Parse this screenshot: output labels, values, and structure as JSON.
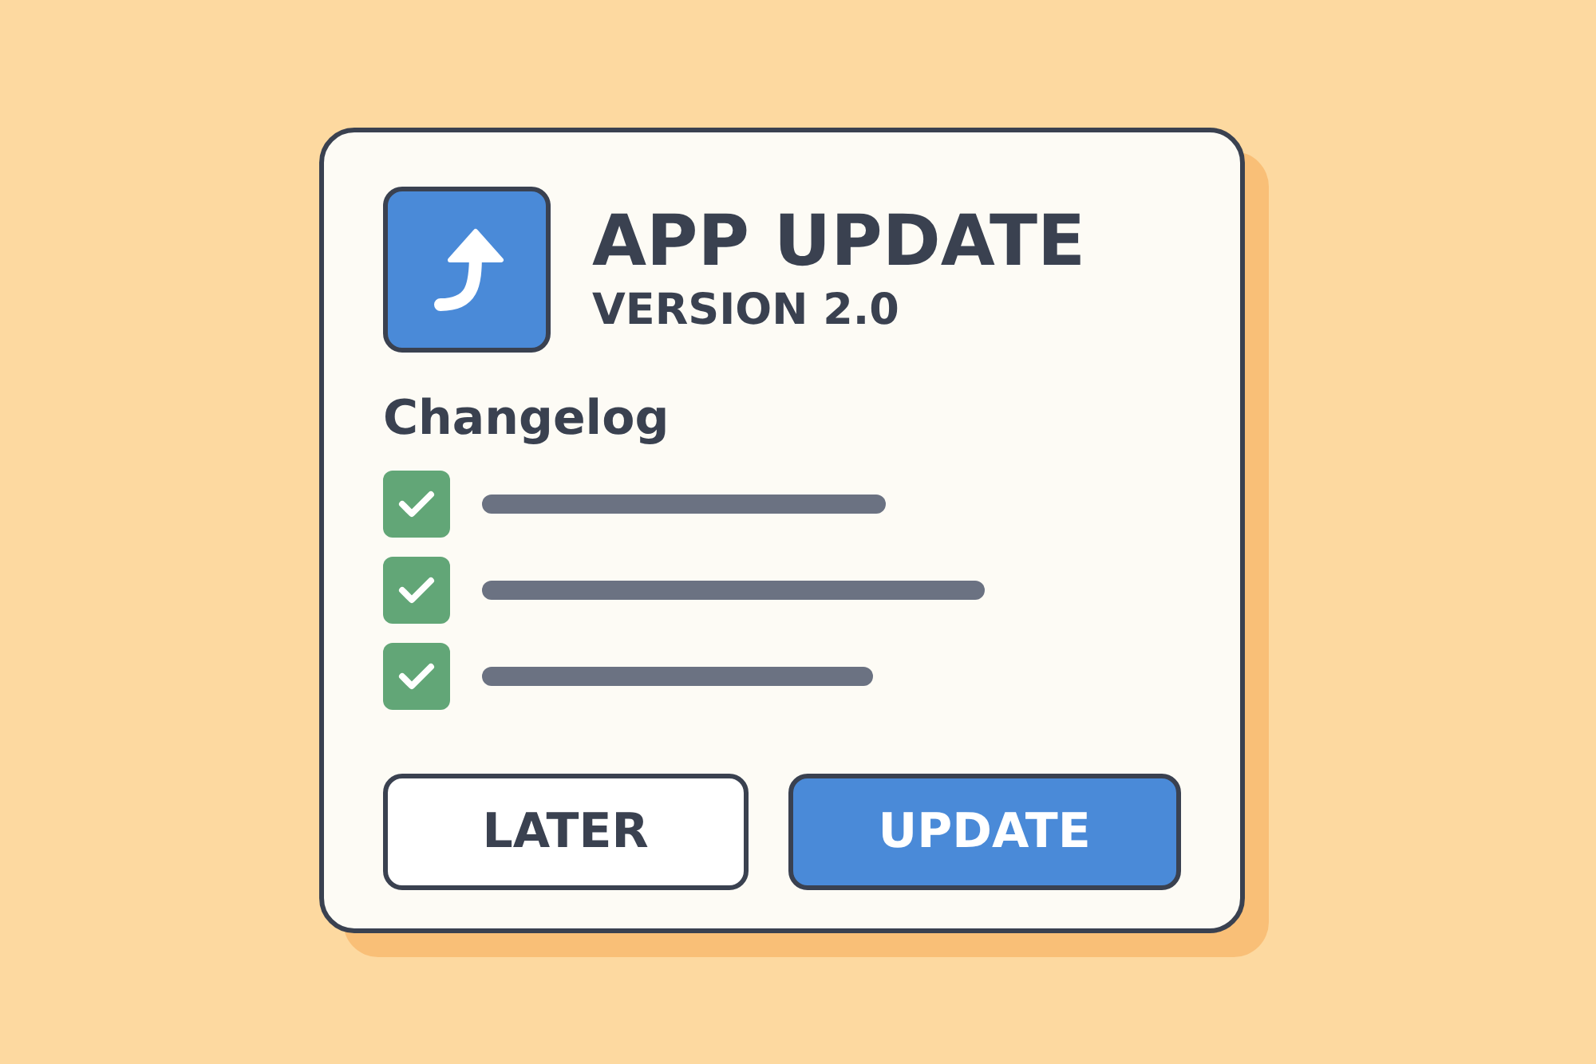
{
  "dialog": {
    "title": "APP UPDATE",
    "subtitle": "VERSION 2.0"
  },
  "changelog": {
    "heading": "Changelog",
    "items": [
      {
        "checked": true
      },
      {
        "checked": true
      },
      {
        "checked": true
      }
    ]
  },
  "buttons": [
    {
      "label": "LATER",
      "kind": "secondary"
    },
    {
      "label": "UPDATE",
      "kind": "primary"
    }
  ]
}
